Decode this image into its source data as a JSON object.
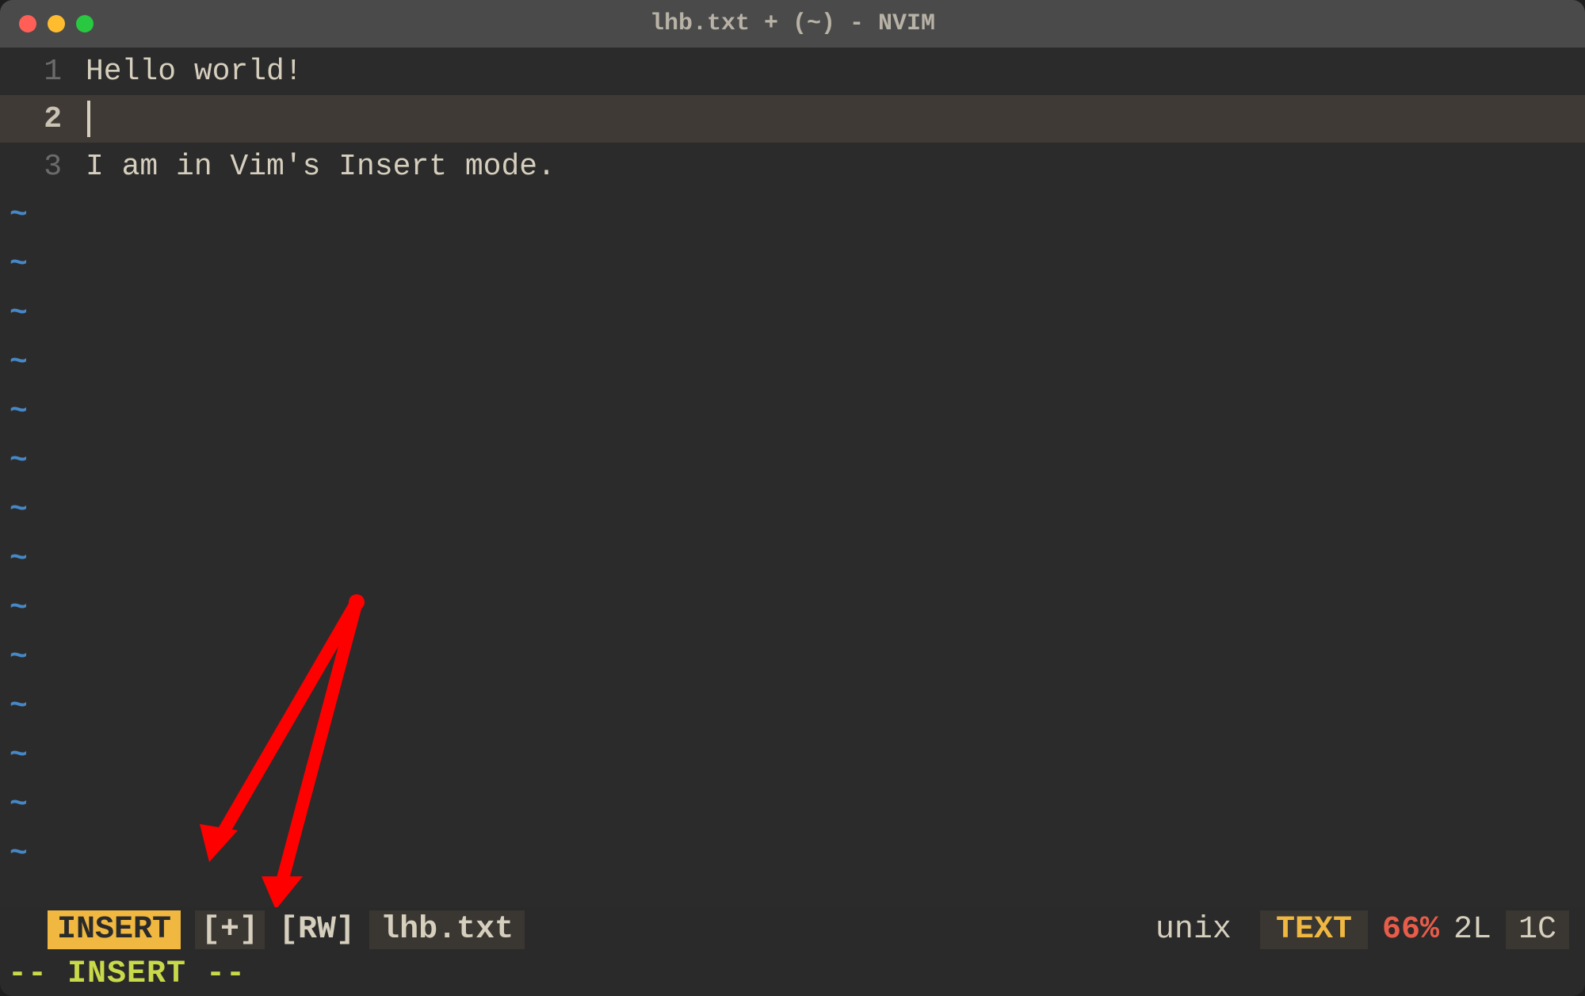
{
  "titlebar": {
    "title": "lhb.txt + (~) - NVIM"
  },
  "editor": {
    "lines": [
      {
        "num": "1",
        "text": "Hello world!",
        "current": false
      },
      {
        "num": "2",
        "text": "",
        "current": true
      },
      {
        "num": "3",
        "text": "I am in Vim's Insert mode.",
        "current": false
      }
    ],
    "tilde": "~"
  },
  "statusline": {
    "mode": "INSERT",
    "modified": "[+]",
    "rw": "[RW]",
    "filename": "lhb.txt",
    "fileformat": "unix",
    "filetype": "TEXT",
    "percent": "66%",
    "lines": "2L",
    "col": "1C"
  },
  "commandline": {
    "text": "-- INSERT --"
  },
  "annotation": {
    "arrow_color": "#ff0000"
  }
}
